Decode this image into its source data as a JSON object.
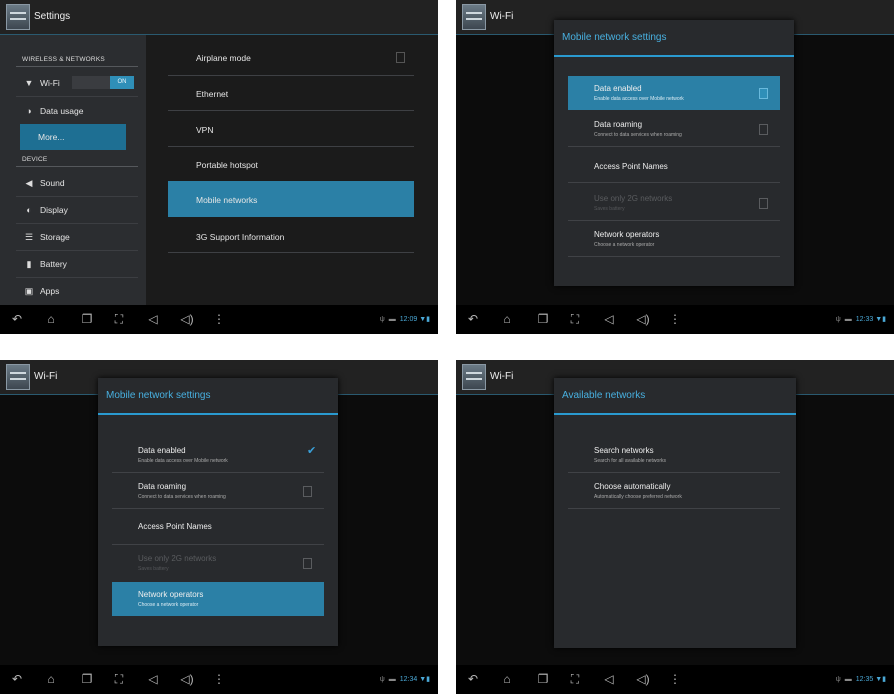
{
  "panels": [
    {
      "id": "p1",
      "title": "Settings",
      "sidebar": {
        "section_wireless": "WIRELESS & NETWORKS",
        "section_device": "DEVICE",
        "items": [
          {
            "label": "Wi-Fi",
            "icon": "wifi-icon"
          },
          {
            "label": "Data usage",
            "icon": "data-usage-icon"
          },
          {
            "label": "More...",
            "icon": ""
          },
          {
            "label": "Sound",
            "icon": "sound-icon"
          },
          {
            "label": "Display",
            "icon": "display-icon"
          },
          {
            "label": "Storage",
            "icon": "storage-icon"
          },
          {
            "label": "Battery",
            "icon": "battery-icon"
          },
          {
            "label": "Apps",
            "icon": "apps-icon"
          }
        ],
        "wifi_toggle": "ON"
      },
      "content": [
        {
          "label": "Airplane mode"
        },
        {
          "label": "Ethernet"
        },
        {
          "label": "VPN"
        },
        {
          "label": "Portable hotspot"
        },
        {
          "label": "Mobile networks"
        },
        {
          "label": "3G Support Information"
        }
      ],
      "time": "12:09"
    },
    {
      "id": "p2",
      "title": "Wi-Fi",
      "dialog": {
        "title": "Mobile network settings",
        "rows": [
          {
            "title": "Data enabled",
            "sub": "Enable data access over Mobile network"
          },
          {
            "title": "Data roaming",
            "sub": "Connect to data services when roaming"
          },
          {
            "title": "Access Point Names",
            "sub": ""
          },
          {
            "title": "Use only 2G networks",
            "sub": "Saves battery"
          },
          {
            "title": "Network operators",
            "sub": "Choose a network operator"
          }
        ]
      },
      "time": "12:33"
    },
    {
      "id": "p3",
      "title": "Wi-Fi",
      "dialog": {
        "title": "Mobile network settings",
        "rows": [
          {
            "title": "Data enabled",
            "sub": "Enable data access over Mobile network"
          },
          {
            "title": "Data roaming",
            "sub": "Connect to data services when roaming"
          },
          {
            "title": "Access Point Names",
            "sub": ""
          },
          {
            "title": "Use only 2G networks",
            "sub": "Saves battery"
          },
          {
            "title": "Network operators",
            "sub": "Choose a network operator"
          }
        ]
      },
      "time": "12:34"
    },
    {
      "id": "p4",
      "title": "Wi-Fi",
      "dialog": {
        "title": "Available networks",
        "rows": [
          {
            "title": "Search networks",
            "sub": "Search for all available networks"
          },
          {
            "title": "Choose automatically",
            "sub": "Automatically choose preferred network"
          }
        ]
      },
      "time": "12:35"
    }
  ],
  "colors": {
    "accent": "#2b80a6",
    "title_blue": "#48b0e0",
    "background": "#1b1b1b"
  }
}
